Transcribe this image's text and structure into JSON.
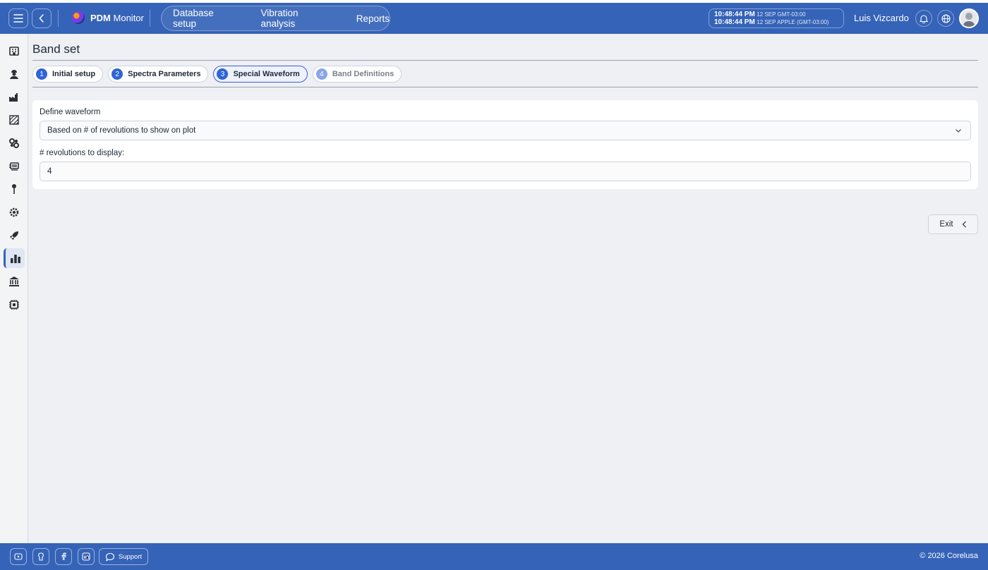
{
  "app": {
    "name_bold": "PDM",
    "name_rest": "Monitor"
  },
  "nav": {
    "items": [
      "Database setup",
      "Vibration analysis",
      "Reports"
    ]
  },
  "clock": {
    "line1_time": "10:48:44 PM",
    "line1_detail": "12 SEP  GMT-03:00",
    "line2_time": "10:48:44 PM",
    "line2_detail": "12 SEP  APPLE (GMT-03:00)"
  },
  "user": {
    "name": "Luis Vizcardo"
  },
  "sidebar": {
    "items": [
      {
        "icon": "building-icon"
      },
      {
        "icon": "worker-icon"
      },
      {
        "icon": "factory-icon"
      },
      {
        "icon": "hatch-area-icon"
      },
      {
        "icon": "gears-icon"
      },
      {
        "icon": "machine-icon"
      },
      {
        "icon": "pin-icon"
      },
      {
        "icon": "gear-cog-icon"
      },
      {
        "icon": "rocket-icon"
      },
      {
        "icon": "bar-chart-icon",
        "active": true
      },
      {
        "icon": "bank-icon"
      },
      {
        "icon": "chip-icon"
      }
    ]
  },
  "page": {
    "title": "Band set"
  },
  "steps": [
    {
      "num": "1",
      "label": "Initial setup",
      "state": "done"
    },
    {
      "num": "2",
      "label": "Spectra Parameters",
      "state": "done"
    },
    {
      "num": "3",
      "label": "Special Waveform",
      "state": "active"
    },
    {
      "num": "4",
      "label": "Band Definitions",
      "state": "disabled"
    }
  ],
  "form": {
    "define_label": "Define waveform",
    "define_value": "Based on # of revolutions to show on plot",
    "revs_label": "# revolutions to display:",
    "revs_value": "4"
  },
  "actions": {
    "exit_label": "Exit"
  },
  "footer": {
    "support_label": "Support",
    "copyright": "© 2026 Corelusa"
  },
  "colors": {
    "brand": "#3563b8",
    "step_active": "#3b5bdb",
    "step_num": "#2f64d6"
  }
}
